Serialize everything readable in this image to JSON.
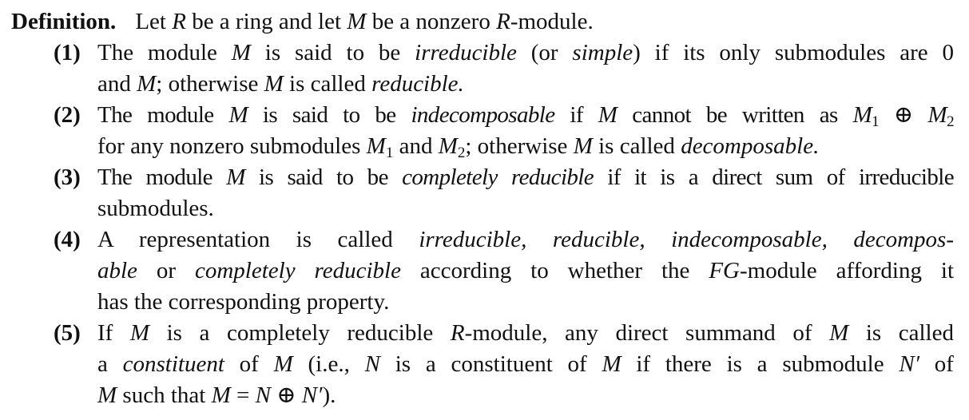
{
  "definition": {
    "label": "Definition.",
    "intro": [
      {
        "t": "Let "
      },
      {
        "t": "R",
        "i": true
      },
      {
        "t": " be a ring and let "
      },
      {
        "t": "M",
        "i": true
      },
      {
        "t": " be a nonzero "
      },
      {
        "t": "R",
        "i": true
      },
      {
        "t": "-module."
      }
    ]
  },
  "items": [
    {
      "number": "(1)",
      "lines": [
        [
          {
            "t": "The module "
          },
          {
            "t": "M",
            "i": true
          },
          {
            "t": " is said to be "
          },
          {
            "t": "irreducible",
            "i": true
          },
          {
            "t": " (or "
          },
          {
            "t": "simple",
            "i": true
          },
          {
            "t": ") if its only submodules are 0"
          }
        ],
        [
          {
            "t": "and "
          },
          {
            "t": "M",
            "i": true
          },
          {
            "t": "; otherwise "
          },
          {
            "t": "M",
            "i": true
          },
          {
            "t": " is called "
          },
          {
            "t": "reducible.",
            "i": true
          }
        ]
      ]
    },
    {
      "number": "(2)",
      "lines": [
        [
          {
            "t": "The module "
          },
          {
            "t": "M",
            "i": true
          },
          {
            "t": " is said to be "
          },
          {
            "t": "indecomposable",
            "i": true
          },
          {
            "t": " if "
          },
          {
            "t": "M",
            "i": true
          },
          {
            "t": " cannot be written as "
          },
          {
            "t": "M",
            "i": true
          },
          {
            "t": "1",
            "sub": true
          },
          {
            "t": " ⊕ "
          },
          {
            "t": "M",
            "i": true
          },
          {
            "t": "2",
            "sub": true
          }
        ],
        [
          {
            "t": "for any nonzero submodules "
          },
          {
            "t": "M",
            "i": true
          },
          {
            "t": "1",
            "sub": true
          },
          {
            "t": " and "
          },
          {
            "t": "M",
            "i": true
          },
          {
            "t": "2",
            "sub": true
          },
          {
            "t": "; otherwise "
          },
          {
            "t": "M",
            "i": true
          },
          {
            "t": " is called "
          },
          {
            "t": "decomposable.",
            "i": true
          }
        ]
      ]
    },
    {
      "number": "(3)",
      "lines": [
        [
          {
            "t": "The module "
          },
          {
            "t": "M",
            "i": true
          },
          {
            "t": " is said to be "
          },
          {
            "t": "completely reducible",
            "i": true
          },
          {
            "t": " if it is a direct sum of irreducible"
          }
        ],
        [
          {
            "t": "submodules."
          }
        ]
      ]
    },
    {
      "number": "(4)",
      "lines": [
        [
          {
            "t": "A representation is called "
          },
          {
            "t": "irreducible, reducible, indecomposable, decompos-",
            "i": true
          }
        ],
        [
          {
            "t": "able",
            "i": true
          },
          {
            "t": " or "
          },
          {
            "t": "completely reducible",
            "i": true
          },
          {
            "t": " according to whether the "
          },
          {
            "t": "FG",
            "i": true
          },
          {
            "t": "-module affording it"
          }
        ],
        [
          {
            "t": "has the corresponding property."
          }
        ]
      ]
    },
    {
      "number": "(5)",
      "lines": [
        [
          {
            "t": "If "
          },
          {
            "t": "M",
            "i": true
          },
          {
            "t": " is a completely reducible "
          },
          {
            "t": "R",
            "i": true
          },
          {
            "t": "-module, any direct summand of "
          },
          {
            "t": "M",
            "i": true
          },
          {
            "t": " is called"
          }
        ],
        [
          {
            "t": "a "
          },
          {
            "t": "constituent",
            "i": true
          },
          {
            "t": " of "
          },
          {
            "t": "M",
            "i": true
          },
          {
            "t": " (i.e., "
          },
          {
            "t": "N",
            "i": true
          },
          {
            "t": " is a constituent of "
          },
          {
            "t": "M",
            "i": true
          },
          {
            "t": " if there is a submodule "
          },
          {
            "t": "N′",
            "i": true
          },
          {
            "t": " of"
          }
        ],
        [
          {
            "t": "M",
            "i": true
          },
          {
            "t": " such that "
          },
          {
            "t": "M",
            "i": true
          },
          {
            "t": " = "
          },
          {
            "t": "N",
            "i": true
          },
          {
            "t": " ⊕ "
          },
          {
            "t": "N′",
            "i": true
          },
          {
            "t": ")."
          }
        ]
      ]
    }
  ]
}
